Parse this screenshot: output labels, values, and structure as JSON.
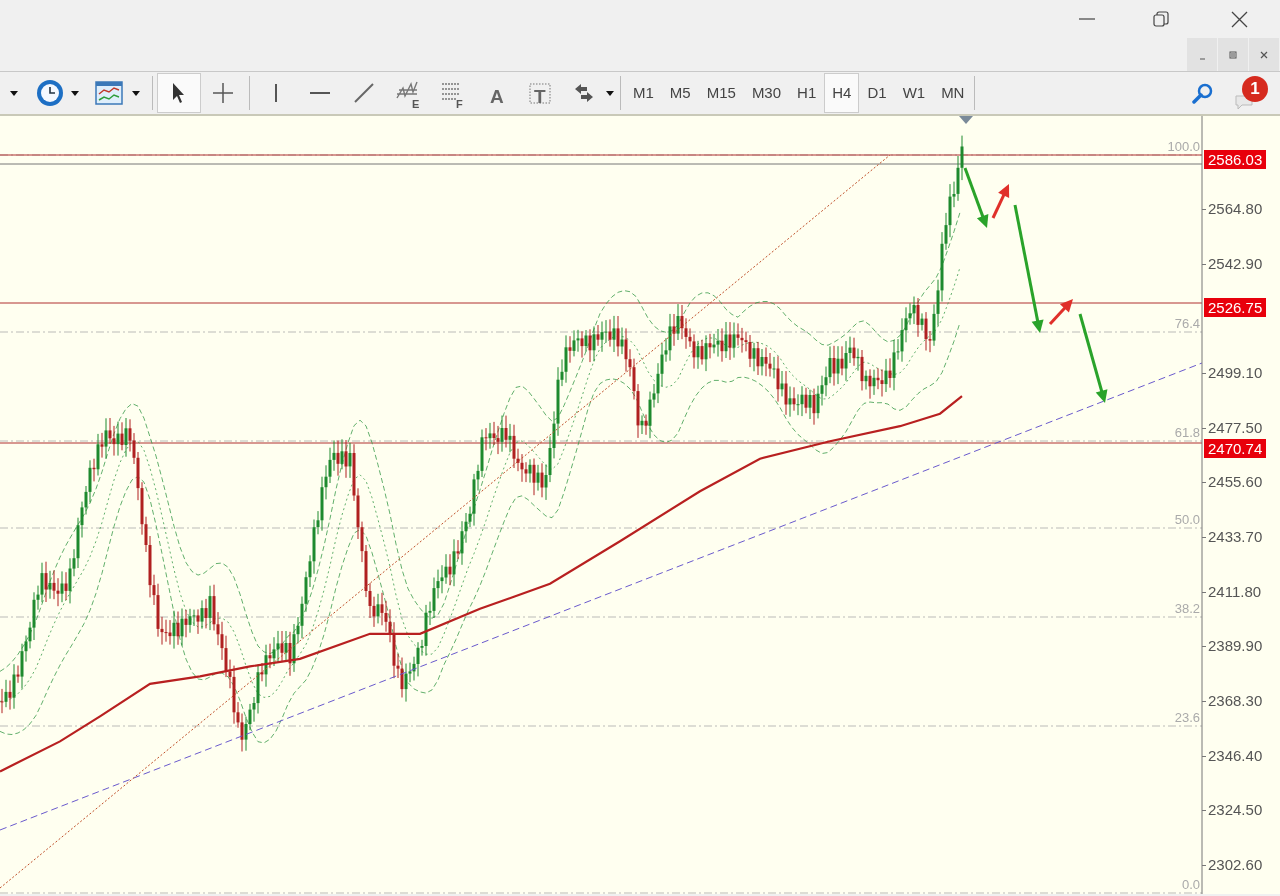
{
  "notification_badge": "1",
  "mdi_controls": [
    {
      "kind": "minimize"
    },
    {
      "kind": "restore"
    },
    {
      "kind": "close"
    }
  ],
  "toolbar": {
    "tools": [
      {
        "kind": "cursor",
        "selected": true
      },
      {
        "kind": "crosshair",
        "selected": false
      },
      {
        "kind": "vline",
        "selected": false
      },
      {
        "kind": "hline",
        "selected": false
      },
      {
        "kind": "trend",
        "selected": false
      },
      {
        "kind": "elliott",
        "letter": "E",
        "selected": false
      },
      {
        "kind": "fibo",
        "letter": "F",
        "selected": false
      },
      {
        "kind": "text",
        "letter": "A",
        "selected": false
      },
      {
        "kind": "label",
        "letter": "T",
        "selected": false
      },
      {
        "kind": "arrows",
        "selected": false
      }
    ],
    "timeframes": [
      {
        "label": "M1",
        "selected": false
      },
      {
        "label": "M5",
        "selected": false
      },
      {
        "label": "M15",
        "selected": false
      },
      {
        "label": "M30",
        "selected": false
      },
      {
        "label": "H1",
        "selected": false
      },
      {
        "label": "H4",
        "selected": true
      },
      {
        "label": "D1",
        "selected": false
      },
      {
        "label": "W1",
        "selected": false
      },
      {
        "label": "MN",
        "selected": false
      }
    ]
  },
  "chart": {
    "price_axis": [
      "2564.80",
      "2542.90",
      "2499.10",
      "2477.50",
      "2455.60",
      "2433.70",
      "2411.80",
      "2389.90",
      "2368.30",
      "2346.40",
      "2324.50",
      "2302.60"
    ],
    "price_tags": [
      "2586.03",
      "2526.75",
      "2470.74"
    ],
    "fibo_levels": [
      "100.0",
      "76.4",
      "61.8",
      "50.0",
      "38.2",
      "23.6",
      "0.0"
    ]
  }
}
